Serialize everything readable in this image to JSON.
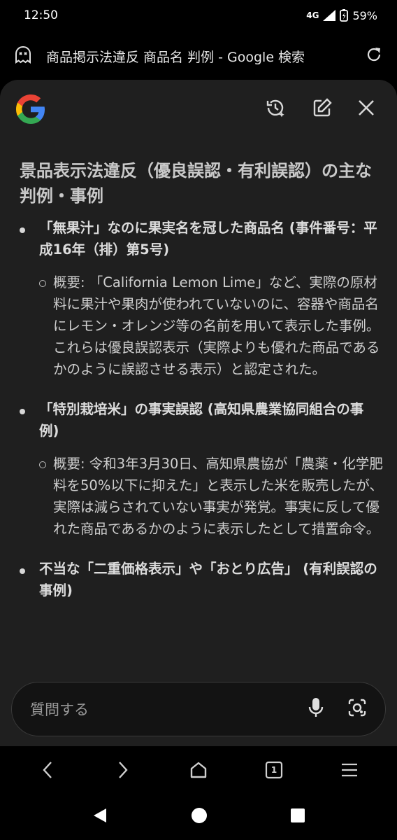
{
  "status": {
    "time": "12:50",
    "network": "4G",
    "battery": "59%"
  },
  "browser": {
    "page_title": "商品掲示法違反 商品名 判例 - Google 検索"
  },
  "panel": {
    "heading": "景品表示法違反（優良誤認・有利誤認）の主な判例・事例",
    "items": [
      {
        "title": "「無果汁」なのに果実名を冠した商品名 (事件番号：平成16年（排）第5号)",
        "detail": "概要: 「California Lemon Lime」など、実際の原材料に果汁や果肉が使われていないのに、容器や商品名にレモン・オレンジ等の名前を用いて表示した事例。これらは優良誤認表示（実際よりも優れた商品であるかのように誤認させる表示）と認定された。"
      },
      {
        "title": "「特別栽培米」の事実誤認 (高知県農業協同組合の事例)",
        "detail": "概要: 令和3年3月30日、高知県農協が「農薬・化学肥料を50%以下に抑えた」と表示した米を販売したが、実際は減らされていない事実が発覚。事実に反して優れた商品であるかのように表示したとして措置命令。"
      },
      {
        "title": "不当な「二重価格表示」や「おとり広告」 (有利誤認の事例)",
        "detail": ""
      }
    ],
    "ask_placeholder": "質問する"
  },
  "icons": {
    "tab_icon": "incognito-ghost-icon",
    "reload": "reload-icon",
    "history": "history-icon",
    "edit": "edit-icon",
    "close": "close-icon",
    "mic": "mic-icon",
    "lens": "lens-icon",
    "back": "back-icon",
    "forward": "forward-icon",
    "home": "home-icon",
    "tabs": "tabs-icon",
    "menu": "menu-icon"
  },
  "browser_nav": {
    "tab_count": "1"
  }
}
